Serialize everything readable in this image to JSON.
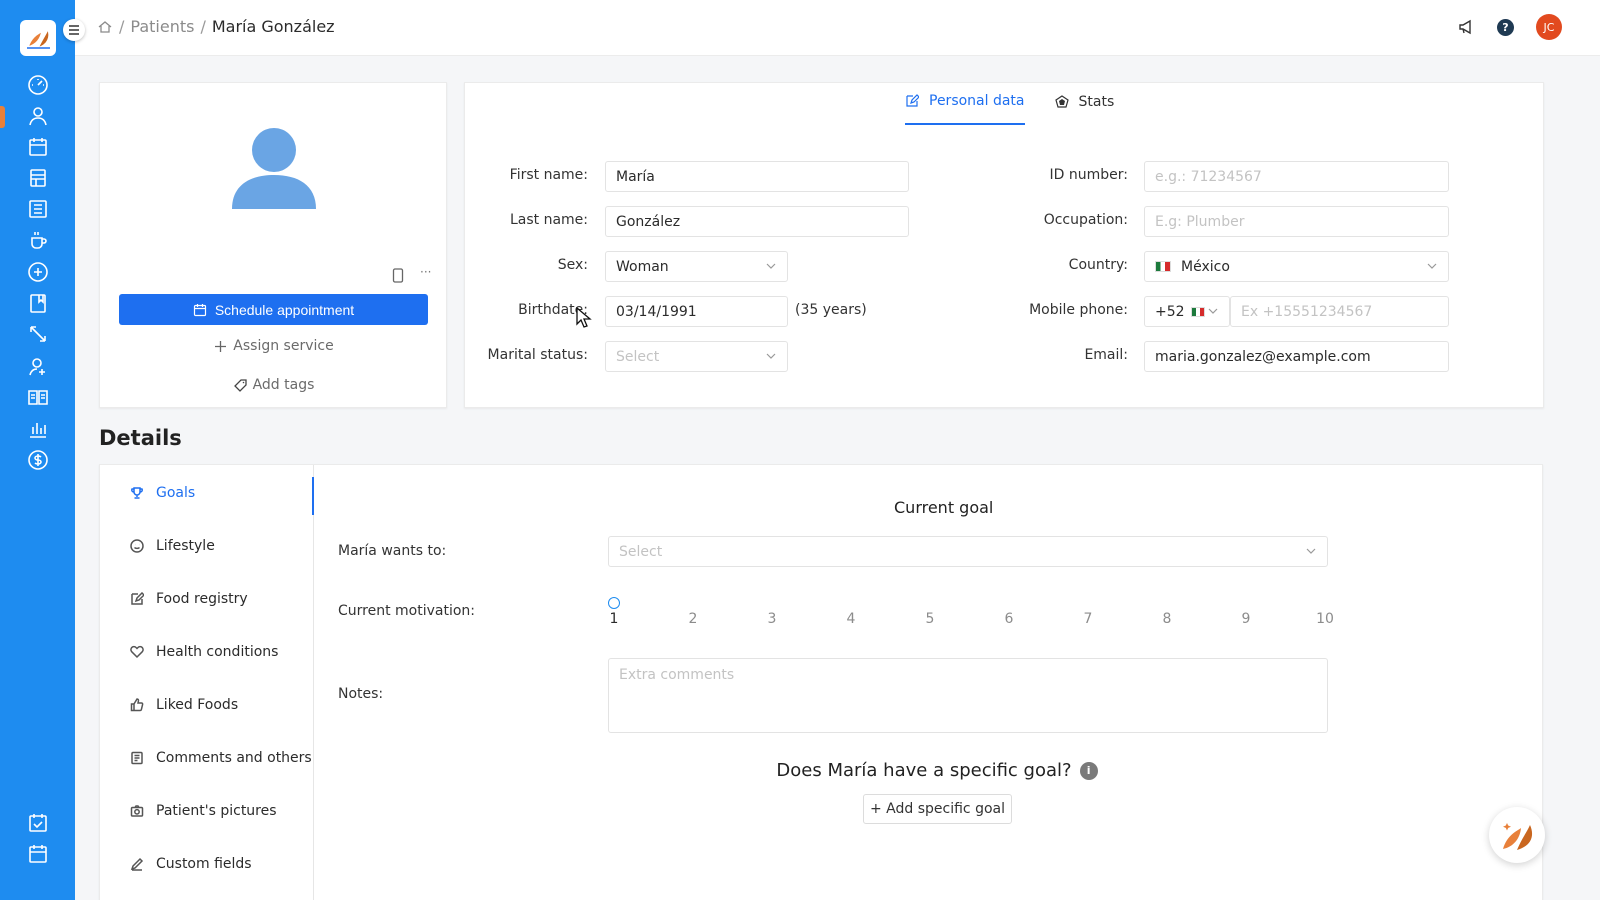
{
  "app": {
    "brand_color": "#1e8cf0",
    "primary_color": "#1e6ff0",
    "accent_color": "#e8803a"
  },
  "rail": {
    "icons": [
      "dashboard-icon",
      "patients-icon",
      "calendar-icon",
      "layout-icon",
      "list-icon",
      "meal-icon",
      "add-circle-icon",
      "bookmark-icon",
      "resize-icon",
      "consult-icon",
      "book-icon",
      "chart-icon",
      "dollar-icon",
      "task-icon",
      "schedule-icon"
    ]
  },
  "breadcrumb": {
    "parent": "Patients",
    "current": "María González"
  },
  "topbar": {
    "user_initials": "JC",
    "help_glyph": "?"
  },
  "profile": {
    "more_glyph": "···",
    "schedule_label": "Schedule appointment",
    "assign_label": "Assign service",
    "tags_label": "Add tags"
  },
  "personal": {
    "tabs": [
      {
        "label": "Personal data",
        "icon": "edit-icon"
      },
      {
        "label": "Stats",
        "icon": "stats-icon"
      }
    ],
    "first_name_label": "First name:",
    "first_name": "María",
    "last_name_label": "Last name:",
    "last_name": "González",
    "sex_label": "Sex:",
    "sex": "Woman",
    "birthdate_label": "Birthdate:",
    "birthdate": "03/14/1991",
    "age": "(35 years)",
    "marital_label": "Marital status:",
    "marital_placeholder": "Select",
    "id_label": "ID number:",
    "id_placeholder": "e.g.: 71234567",
    "occupation_label": "Occupation:",
    "occupation_placeholder": "E.g: Plumber",
    "country_label": "Country:",
    "country": "México",
    "phone_label": "Mobile phone:",
    "phone_code": "+52",
    "phone_placeholder": "Ex +15551234567",
    "email_label": "Email:",
    "email": "maria.gonzalez@example.com"
  },
  "details": {
    "title": "Details",
    "nav": [
      {
        "label": "Goals",
        "icon": "trophy-icon",
        "active": true
      },
      {
        "label": "Lifestyle",
        "icon": "smile-icon"
      },
      {
        "label": "Food registry",
        "icon": "edit-icon"
      },
      {
        "label": "Health conditions",
        "icon": "heart-icon"
      },
      {
        "label": "Liked Foods",
        "icon": "thumbs-up-icon"
      },
      {
        "label": "Comments and others",
        "icon": "notes-icon"
      },
      {
        "label": "Patient's pictures",
        "icon": "camera-icon"
      },
      {
        "label": "Custom fields",
        "icon": "pen-icon"
      }
    ],
    "goal_title": "Current goal",
    "wants_label": "María wants to:",
    "wants_placeholder": "Select",
    "motivation_label": "Current motivation:",
    "motivation_scale": [
      "1",
      "2",
      "3",
      "4",
      "5",
      "6",
      "7",
      "8",
      "9",
      "10"
    ],
    "motivation_selected": 1,
    "notes_label": "Notes:",
    "notes_placeholder": "Extra comments",
    "specific_question": "Does María have a specific goal?",
    "info_glyph": "i",
    "add_specific_label": "+ Add specific goal"
  }
}
